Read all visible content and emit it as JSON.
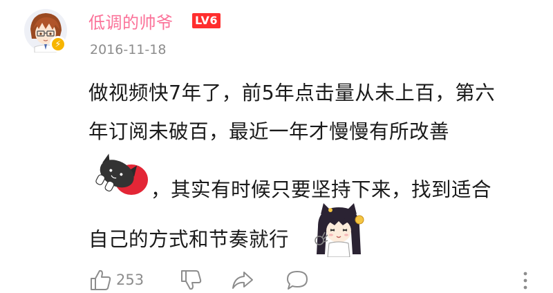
{
  "comment": {
    "username": "低调的帅爷",
    "level": "LV6",
    "date": "2016-11-18",
    "lines": [
      "做视频快7年了，前5年点击量从未上百，第六",
      "年订阅未破百，最近一年才慢慢有所改善",
      "，其实有时候只要坚持下来，找到适合",
      "自己的方式和节奏就行"
    ],
    "likes": "253"
  },
  "colors": {
    "username": "#fb7299",
    "level_bg": "#ff2e2e",
    "badge": "#f7b500",
    "meta": "#8c8c8c"
  },
  "icons": {
    "like": "thumbs-up-icon",
    "dislike": "thumbs-down-icon",
    "share": "share-arrow-icon",
    "reply": "speech-bubble-icon",
    "more": "vertical-dots-icon"
  }
}
